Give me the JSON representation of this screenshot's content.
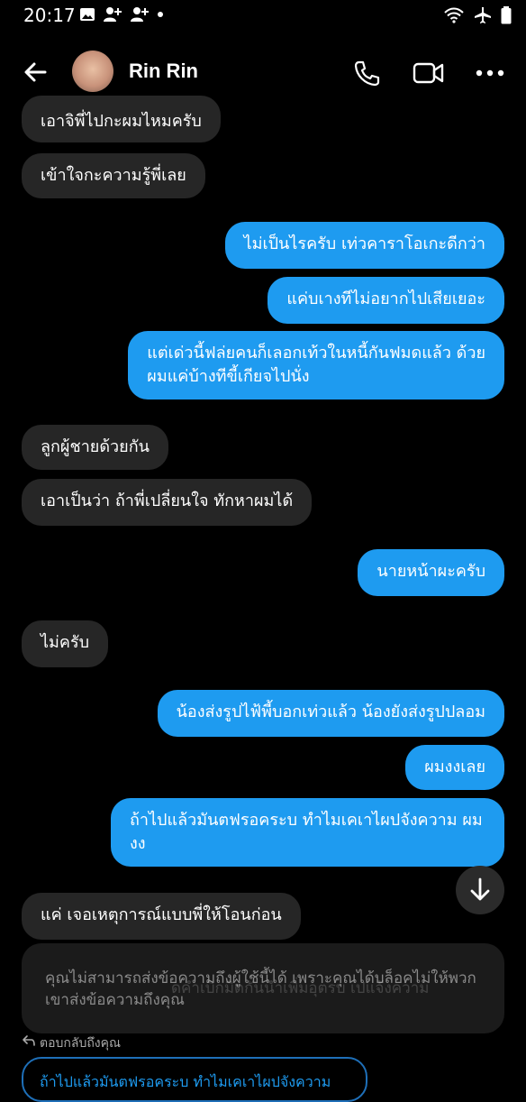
{
  "status_bar": {
    "time": "20:17",
    "left_icons": [
      "image-icon",
      "person-add-icon",
      "person-add-icon",
      "dot-icon"
    ],
    "right_icons": [
      "wifi-icon",
      "airplane-icon",
      "battery-icon"
    ]
  },
  "header": {
    "contact_name": "Rin Rin",
    "actions": [
      "phone-icon",
      "video-call-icon",
      "more-icon"
    ]
  },
  "messages": [
    {
      "direction": "in",
      "text": "เอาจิพี่ไปกะผมไหมครับ"
    },
    {
      "direction": "in",
      "text": "เข้าใจกะความรู้พี่เลย"
    },
    {
      "direction": "out",
      "text": "ไม่เป็นไรครับ เท่วคาราโอเกะดีกว่า"
    },
    {
      "direction": "out",
      "text": "แค่บเางทีไม่อยากไปเสียเยอะ"
    },
    {
      "direction": "out",
      "line1": "แต่เด่วนี้ฟล่ยคนก็เลอกเท้วในหนี้กันฟมดแล้ว ด้วย",
      "line2": "ผมแค่บ้างทีขี้เกียจไปนั่ง"
    },
    {
      "direction": "in",
      "text": "ลูกผู้ชายด้วยกัน"
    },
    {
      "direction": "in",
      "text": "เอาเป็นว่า ถ้าพี่เปลี่ยนใจ ทักหาผมได้"
    },
    {
      "direction": "out",
      "text": "นายหน้าผะครับ"
    },
    {
      "direction": "in",
      "text": "ไม่ครับ"
    },
    {
      "direction": "out",
      "text": "น้องส่งรูปไฟ้พี้บอกเท่วแล้ว น้องยังส่งรูปปลอม"
    },
    {
      "direction": "out",
      "text": "ผมงงเลย"
    },
    {
      "direction": "out",
      "line1": "ถ้าไปแล้วมันตฟรอคระบ ทำไมเคเาไผปจังความ ผม",
      "line2": "งง"
    },
    {
      "direction": "in",
      "text": "แค่ เจอเหตุการณ์แบบพี่ให้โอนก่อน"
    }
  ],
  "notice": {
    "text": "คุณไม่สามารถส่งข้อความถึงผู้ใช้นี้ได้ เพราะคุณได้บล็อคไม่ให้พวกเขาส่งข้อความถึงคุณ",
    "ghost_overlay": "ดคำเบิกมิดกันนำเพิ่มอุตรบ เปแจ้งความ"
  },
  "reply": {
    "label": "ตอบกลับถึงคุณ",
    "preview": "ถ้าไปแล้วมันตฟรอคระบ ทำไมเคเาไผปจังความ"
  },
  "colors": {
    "outgoing_bubble": "#1e9bf0",
    "incoming_bubble": "#262626",
    "background": "#000000"
  }
}
